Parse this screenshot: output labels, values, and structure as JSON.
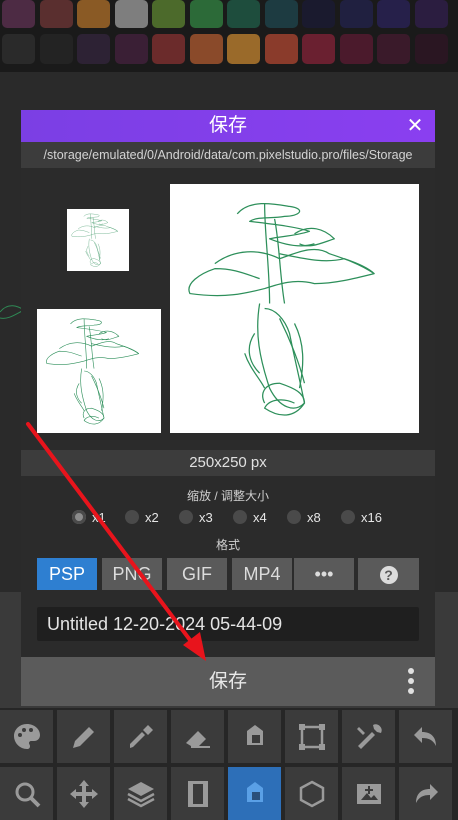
{
  "palette": {
    "row1": [
      "#4d2b44",
      "#5a2f2f",
      "#8a5a25",
      "#7e7e7e",
      "#4c6a2b",
      "#2c6a38",
      "#1e4d3d",
      "#1d3b41",
      "#1a1a2e",
      "#202040",
      "#26204a",
      "#2b1d40"
    ],
    "row2": [
      "#2a2a2a",
      "#232323",
      "#2d2234",
      "#3a1f35",
      "#6b2b2b",
      "#8a4a2a",
      "#9a6a2a",
      "#8a3b2b",
      "#6a2030",
      "#4b1a2c",
      "#3a1a2a",
      "#2a1622"
    ]
  },
  "dialog": {
    "title": "保存",
    "close_icon": "close-icon",
    "path": "/storage/emulated/0/Android/data/com.pixelstudio.pro/files/Storage",
    "size_text": "250x250 px",
    "scale_label": "缩放 / 调整大小",
    "scale_options": [
      "x1",
      "x2",
      "x3",
      "x4",
      "x8",
      "x16"
    ],
    "scale_selected": "x1",
    "format_label": "格式",
    "formats": [
      "PSP",
      "PNG",
      "GIF",
      "MP4",
      "•••",
      "?"
    ],
    "format_selected": "PSP",
    "filename": "Untitled 12-20-2024 05-44-09",
    "save_label": "保存",
    "more_icon": "more-vertical-icon"
  },
  "toolbar": {
    "row1": [
      "palette-icon",
      "pencil-icon",
      "eyedropper-icon",
      "eraser-icon",
      "bucket-icon",
      "select-icon",
      "tools-icon",
      "undo-icon"
    ],
    "row2": [
      "zoom-icon",
      "move-icon",
      "layers-icon",
      "film-icon",
      "bucket-active-icon",
      "shape-icon",
      "image-add-icon",
      "redo-icon"
    ]
  },
  "colors": {
    "accent": "#8a3ff0",
    "format_active": "#2e7fd1",
    "annotation_arrow": "#e8141c"
  }
}
